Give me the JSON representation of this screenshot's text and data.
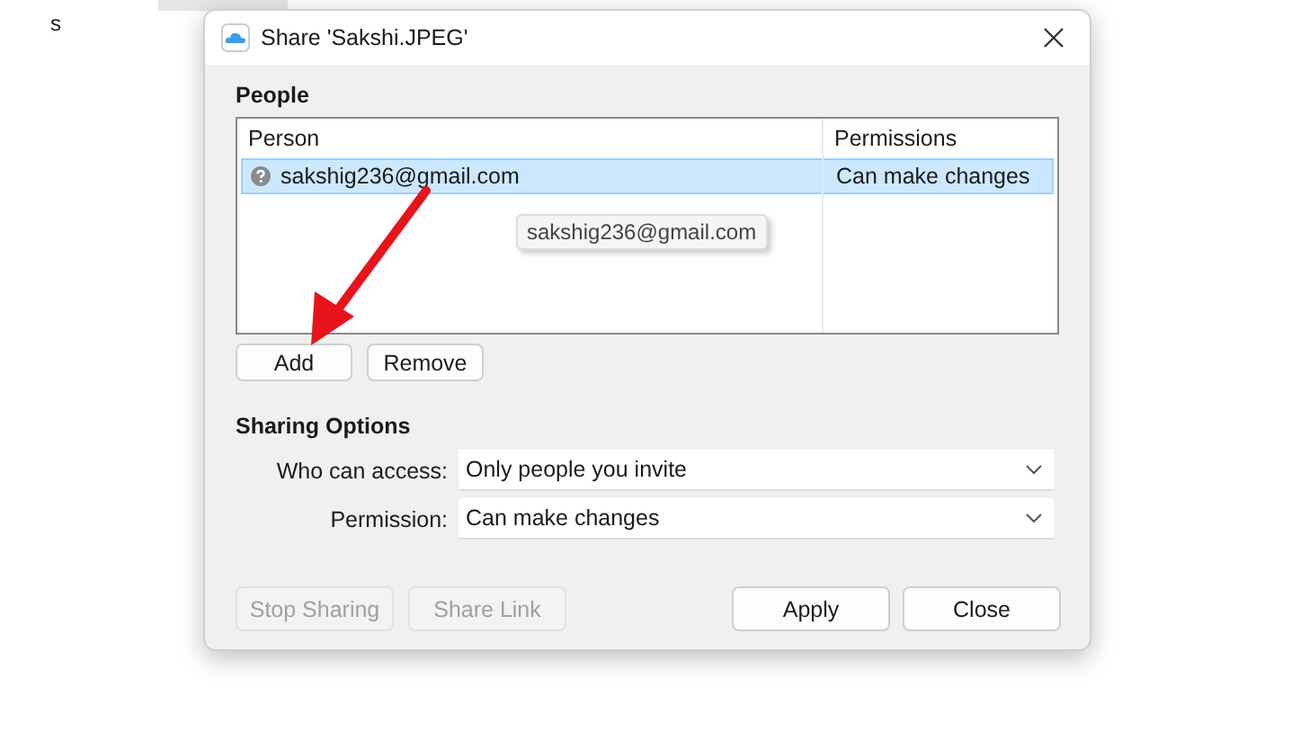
{
  "background": {
    "text": "s"
  },
  "window": {
    "title": "Share 'Sakshi.JPEG'"
  },
  "people": {
    "heading": "People",
    "columns": [
      "Person",
      "Permissions"
    ],
    "rows": [
      {
        "person": "sakshig236@gmail.com",
        "permissions": "Can make changes",
        "selected": true
      }
    ],
    "tooltip": "sakshig236@gmail.com",
    "buttons": [
      {
        "label": "Add",
        "disabled": false
      },
      {
        "label": "Remove",
        "disabled": false
      }
    ]
  },
  "sharing_options": {
    "heading": "Sharing Options",
    "fields": [
      {
        "label": "Who can access:",
        "value": "Only people you invite"
      },
      {
        "label": "Permission:",
        "value": "Can make changes"
      }
    ]
  },
  "left_buttons": [
    {
      "label": "Stop Sharing",
      "disabled": true
    },
    {
      "label": "Share Link",
      "disabled": true
    }
  ],
  "right_buttons": [
    {
      "label": "Apply",
      "disabled": false
    },
    {
      "label": "Close",
      "disabled": false
    }
  ]
}
